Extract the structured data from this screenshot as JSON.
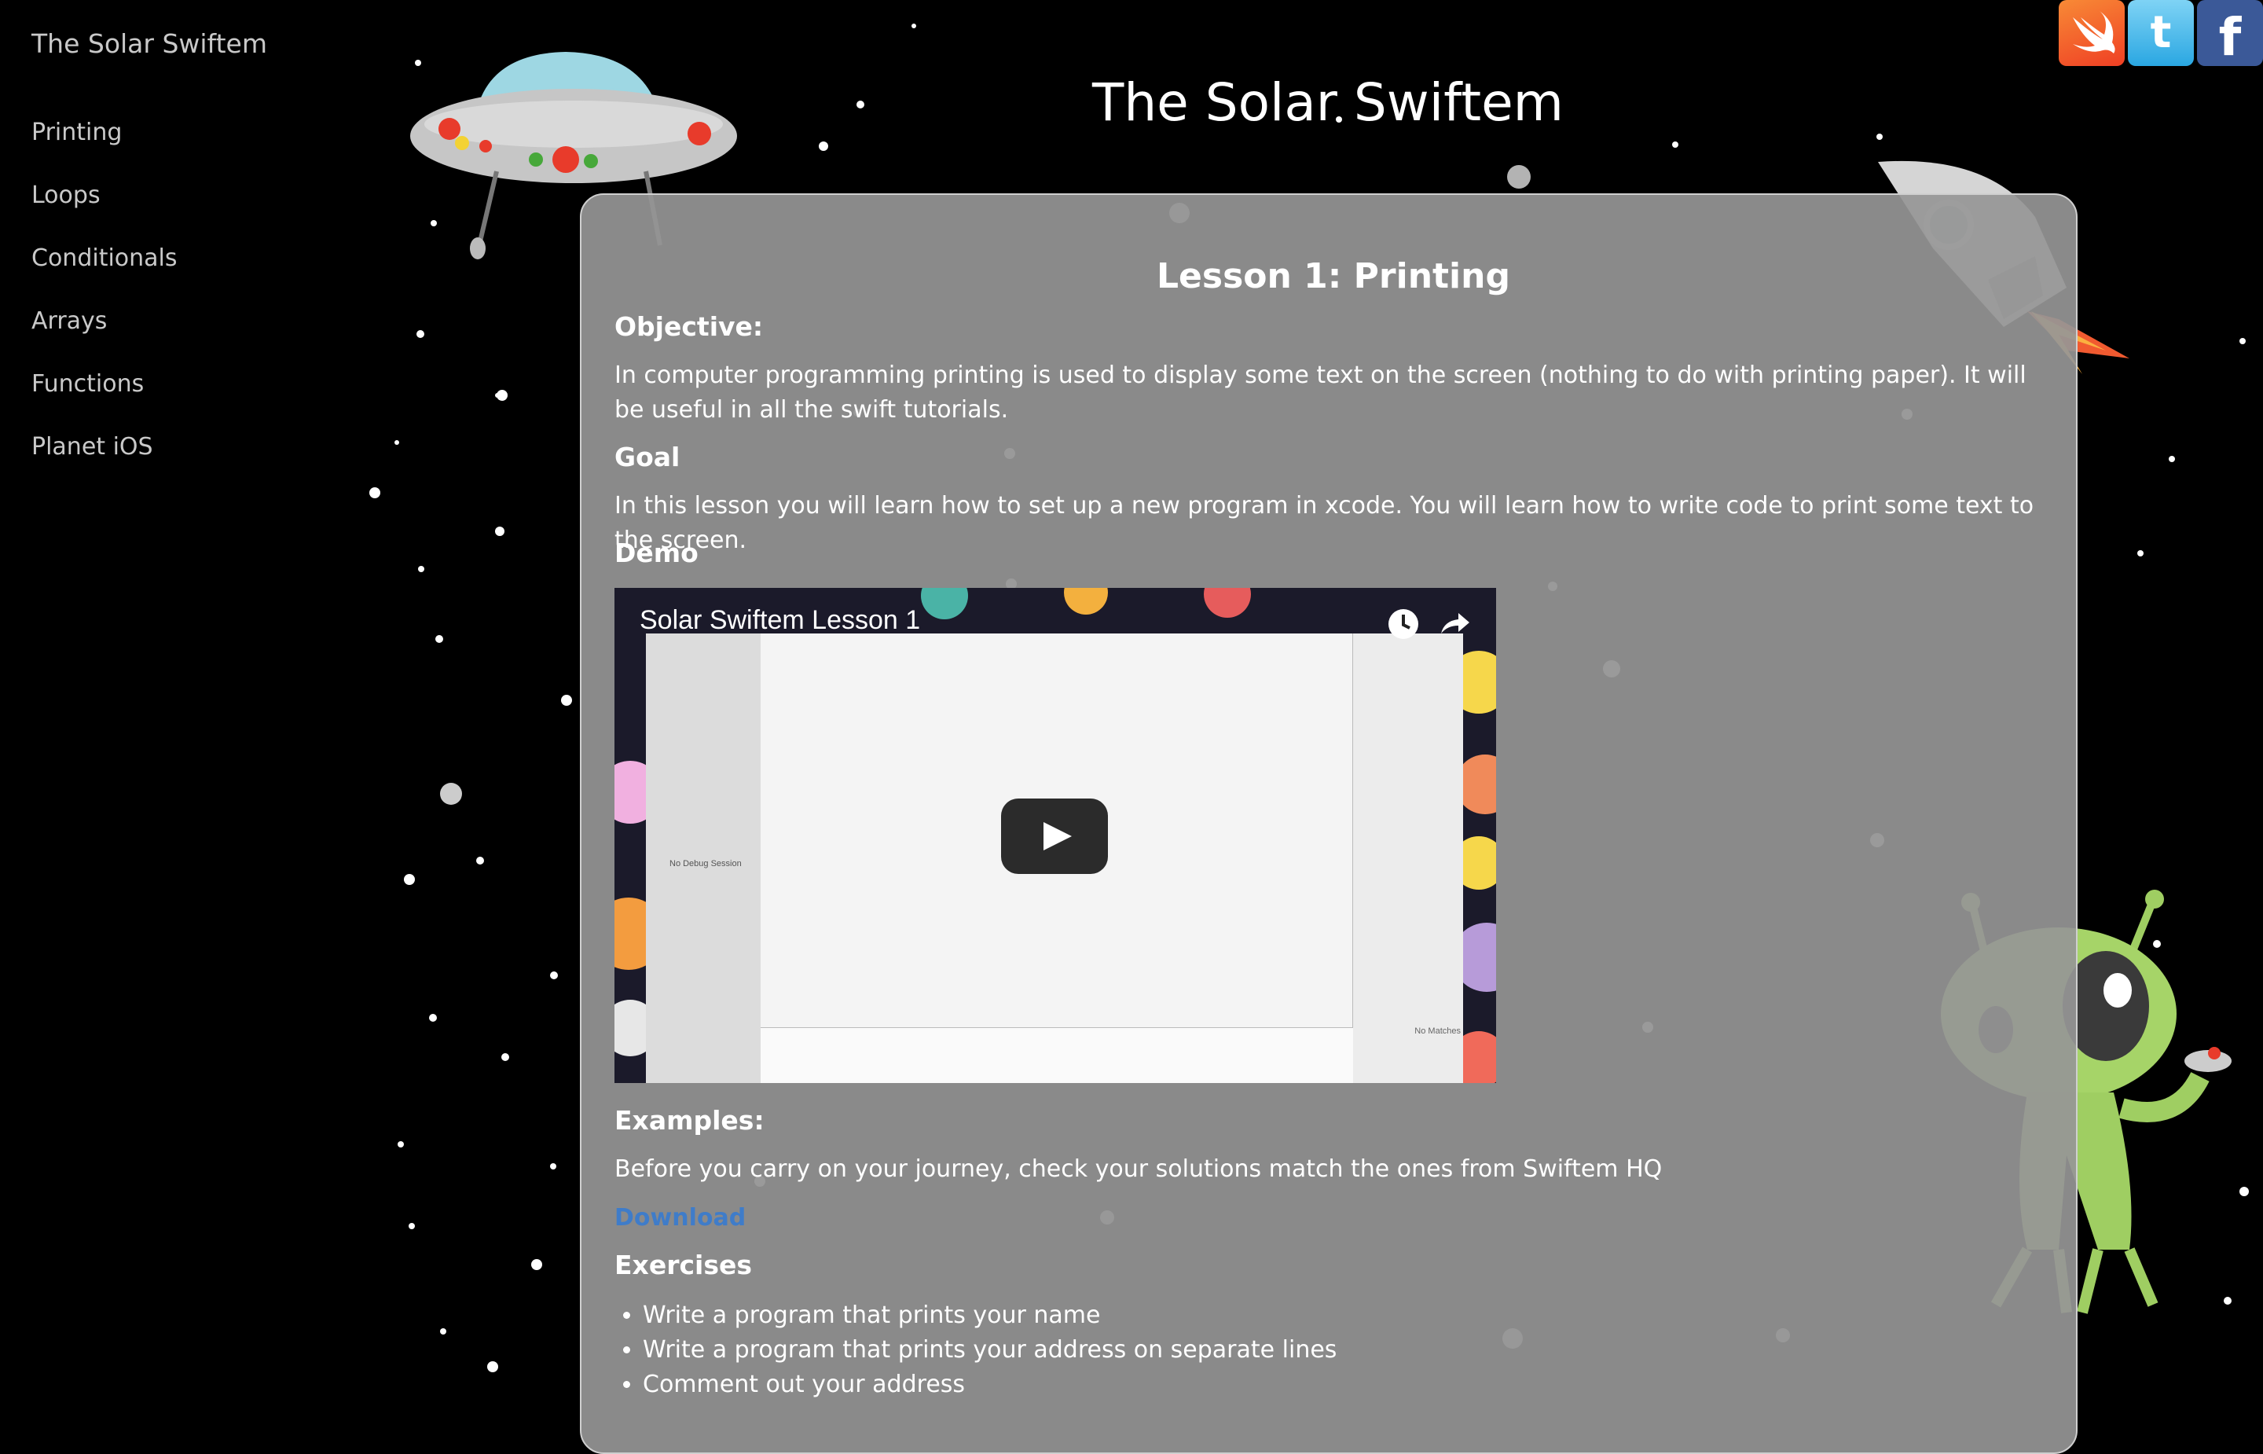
{
  "sidebar": {
    "brand": "The Solar Swiftem",
    "items": [
      {
        "label": "Printing"
      },
      {
        "label": "Loops"
      },
      {
        "label": "Conditionals"
      },
      {
        "label": "Arrays"
      },
      {
        "label": "Functions"
      },
      {
        "label": "Planet iOS"
      }
    ]
  },
  "header": {
    "title": "The Solar Swiftem"
  },
  "social": [
    {
      "icon": "swift-icon"
    },
    {
      "icon": "twitter-icon"
    },
    {
      "icon": "facebook-icon"
    }
  ],
  "lesson": {
    "title": "Lesson 1: Printing",
    "objective_heading": "Objective:",
    "objective_text": "In computer programming printing is used to display some text on the screen (nothing to do with printing paper). It will be useful in all the swift tutorials.",
    "goal_heading": "Goal",
    "goal_text": "In this lesson you will learn how to set up a new program in xcode. You will learn how to write code to print some text to the screen.",
    "demo_heading": "Demo",
    "video": {
      "title": "Solar Swiftem Lesson 1",
      "debug_label": "No Debug Session",
      "no_matches_label": "No Matches"
    },
    "examples_heading": "Examples:",
    "examples_text": "Before you carry on your journey, check your solutions match the ones from Swiftem HQ",
    "download_label": "Download",
    "exercises_heading": "Exercises",
    "exercises": [
      "Write a program that prints your name",
      "Write a program that prints your address on separate lines",
      "Comment out your address"
    ]
  },
  "colors": {
    "background": "#000000",
    "panel": "#969696",
    "link": "#3f7cc9",
    "nav_text": "#c9c9c9"
  }
}
